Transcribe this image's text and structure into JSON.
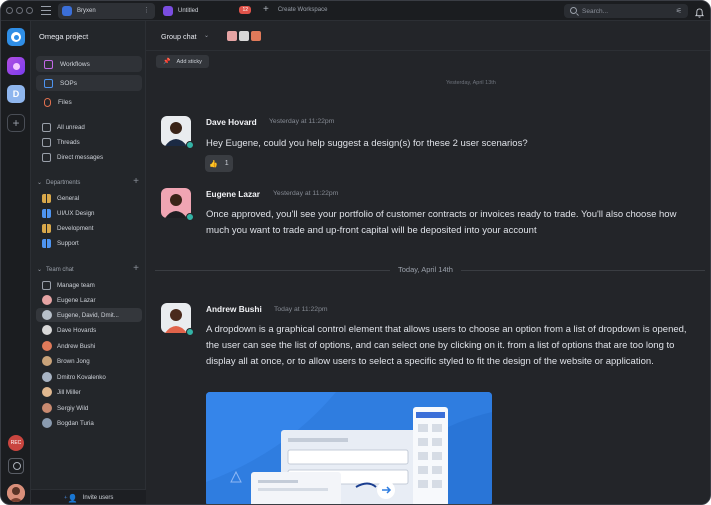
{
  "topbar": {
    "tabs": [
      {
        "label": "Bryxen",
        "active": true
      },
      {
        "label": "Untitled",
        "badge": "12"
      }
    ],
    "create_workspace": "Create Workspace",
    "search_placeholder": "Search..."
  },
  "rail": {
    "workspaces": [
      "",
      "",
      "D"
    ],
    "bottom_badge": "REC"
  },
  "sidebar": {
    "project": "Omega project",
    "nav": [
      {
        "label": "Workflows",
        "icon": "workflow-icon",
        "selected": true
      },
      {
        "label": "SOPs",
        "icon": "document-icon",
        "selected": true
      },
      {
        "label": "Files",
        "icon": "paperclip-icon",
        "selected": false
      }
    ],
    "general": [
      {
        "label": "All unread",
        "icon": "inbox-icon"
      },
      {
        "label": "Threads",
        "icon": "threads-icon"
      },
      {
        "label": "Direct messages",
        "icon": "dm-icon"
      }
    ],
    "departments_label": "Departments",
    "departments": [
      "General",
      "UI/UX Design",
      "Development",
      "Support"
    ],
    "team_label": "Team chat",
    "team": [
      "Manage team",
      "Eugene Lazar",
      "Eugene, David, Dmit...",
      "Dave Hovards",
      "Andrew Bushi",
      "Brown Jong",
      "Dmitro Kovalenko",
      "Jill Miller",
      "Sergiy Wild",
      "Bogdan Turia"
    ],
    "invite": "Invite users"
  },
  "main": {
    "title": "Group chat",
    "add_sticky": "Add sticky",
    "top_date": "Yesterday, April 13th",
    "divider_label": "Today, April 14th",
    "messages": [
      {
        "author": "Dave Hovard",
        "time": "Yesterday at 11:22pm",
        "text": "Hey Eugene, could you help suggest a design(s) for these 2 user scenarios?",
        "reaction": "👍",
        "reaction_count": "1"
      },
      {
        "author": "Eugene Lazar",
        "time": "Yesterday at 11:22pm",
        "text": "Once approved, you'll see your portfolio of customer contracts or invoices ready to trade. You'll also choose how much you want to trade and up-front capital will be deposited into your account"
      },
      {
        "author": "Andrew Bushi",
        "time": "Today at 11:22pm",
        "text": "A dropdown is a graphical control element that allows users to choose an option from a list of dropdown is opened, the user can see the list of options, and can select one by clicking on it. from a list of options that are too long to display all at once, or to allow users to select a specific styled to fit the design of the website or application."
      }
    ]
  },
  "colors": {
    "background": "#232529",
    "sidebar": "#23262a",
    "accent": "#2f8ee6",
    "online": "#33b3a6",
    "badge": "#e0534a"
  }
}
